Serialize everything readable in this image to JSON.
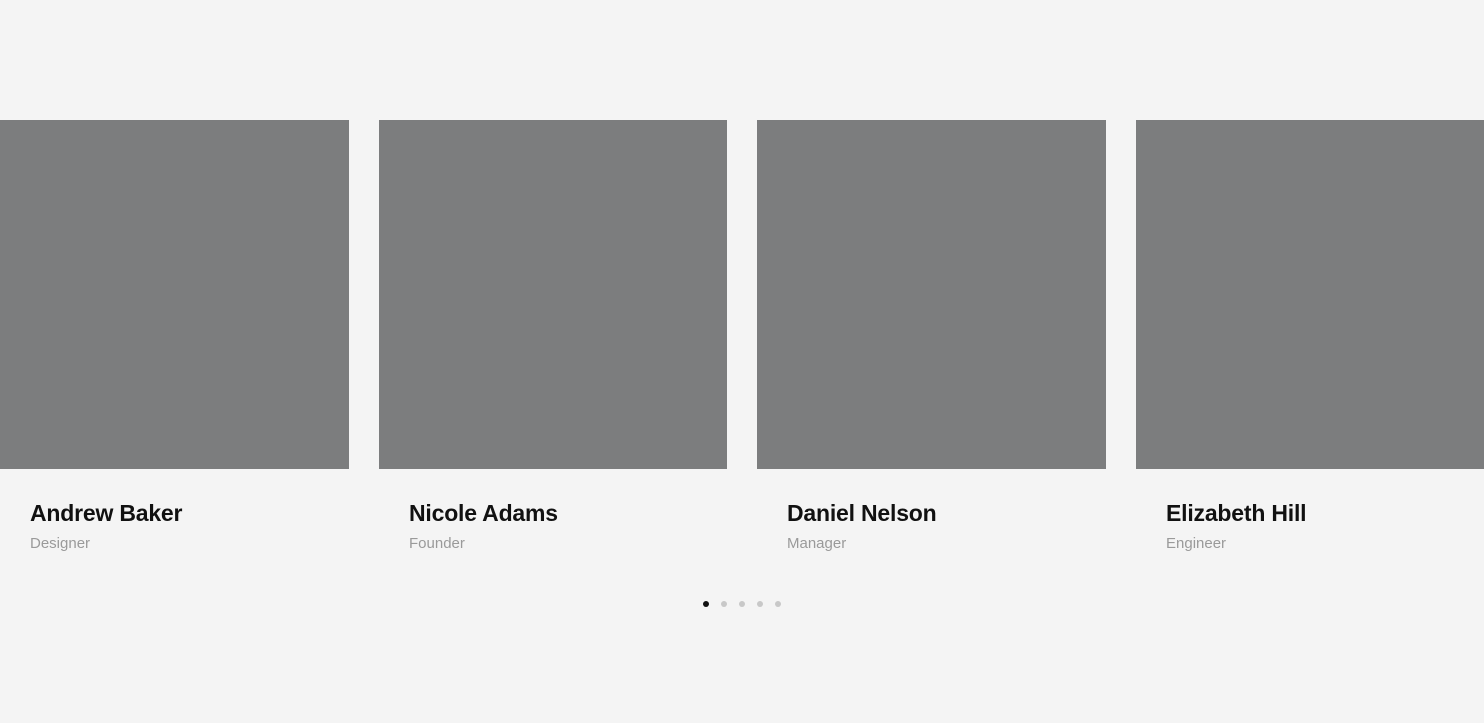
{
  "team": [
    {
      "name": "Andrew Baker",
      "role": "Designer"
    },
    {
      "name": "Nicole Adams",
      "role": "Founder"
    },
    {
      "name": "Daniel Nelson",
      "role": "Manager"
    },
    {
      "name": "Elizabeth Hill",
      "role": "Engineer"
    }
  ],
  "pagination": {
    "total_pages": 5,
    "active_page": 1
  },
  "colors": {
    "background": "#f4f4f4",
    "photo_placeholder": "#7c7d7e",
    "name_text": "#111111",
    "role_text": "#9a9a9a",
    "dot_active": "#111111",
    "dot_inactive": "#c8c8c8"
  }
}
